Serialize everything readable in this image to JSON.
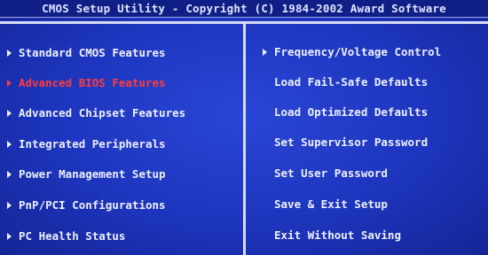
{
  "title": "CMOS Setup Utility - Copyright (C) 1984-2002 Award Software",
  "left_menu": [
    {
      "label": "Standard CMOS Features",
      "arrow": true,
      "selected": false
    },
    {
      "label": "Advanced BIOS Features",
      "arrow": true,
      "selected": true
    },
    {
      "label": "Advanced Chipset Features",
      "arrow": true,
      "selected": false
    },
    {
      "label": "Integrated Peripherals",
      "arrow": true,
      "selected": false
    },
    {
      "label": "Power Management Setup",
      "arrow": true,
      "selected": false
    },
    {
      "label": "PnP/PCI Configurations",
      "arrow": true,
      "selected": false
    },
    {
      "label": "PC Health Status",
      "arrow": true,
      "selected": false
    }
  ],
  "right_menu": [
    {
      "label": "Frequency/Voltage Control",
      "arrow": true
    },
    {
      "label": "Load Fail-Safe Defaults",
      "arrow": false
    },
    {
      "label": "Load Optimized Defaults",
      "arrow": false
    },
    {
      "label": "Set Supervisor Password",
      "arrow": false
    },
    {
      "label": "Set User Password",
      "arrow": false
    },
    {
      "label": "Save & Exit Setup",
      "arrow": false
    },
    {
      "label": "Exit Without Saving",
      "arrow": false
    }
  ],
  "colors": {
    "background": "#1d35bd",
    "text": "#eef0ff",
    "selected_text": "#ff3b3b"
  }
}
